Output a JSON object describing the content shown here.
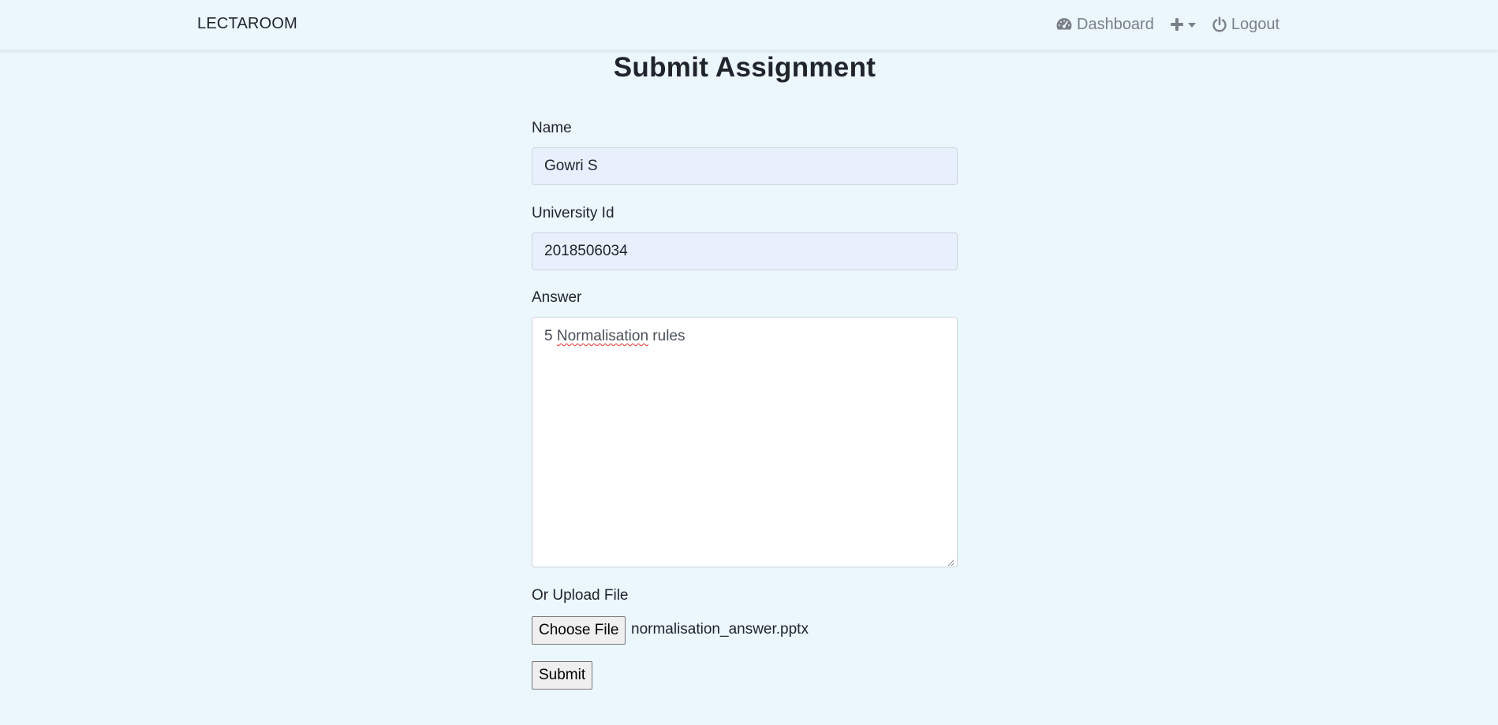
{
  "navbar": {
    "brand": "LECTAROOM",
    "dashboard_label": "Dashboard",
    "logout_label": "Logout",
    "icons": [
      "dashboard-gauge-icon",
      "plus-icon",
      "chevron-down-icon",
      "power-icon"
    ]
  },
  "page": {
    "title": "Submit Assignment"
  },
  "form": {
    "name_label": "Name",
    "name_value": "Gowri S",
    "university_id_label": "University Id",
    "university_id_value": "2018506034",
    "answer_label": "Answer",
    "answer_prefix": "5 ",
    "answer_misspelled": "Normalisation",
    "answer_suffix": " rules",
    "upload_label": "Or Upload File",
    "choose_file_label": "Choose File",
    "file_name": "normalisation_answer.pptx",
    "submit_label": "Submit"
  },
  "colors": {
    "background": "#ebf6fd",
    "input_autofill": "#e8f0fe",
    "nav_text": "#7b8085",
    "spellcheck": "#e0322c"
  }
}
